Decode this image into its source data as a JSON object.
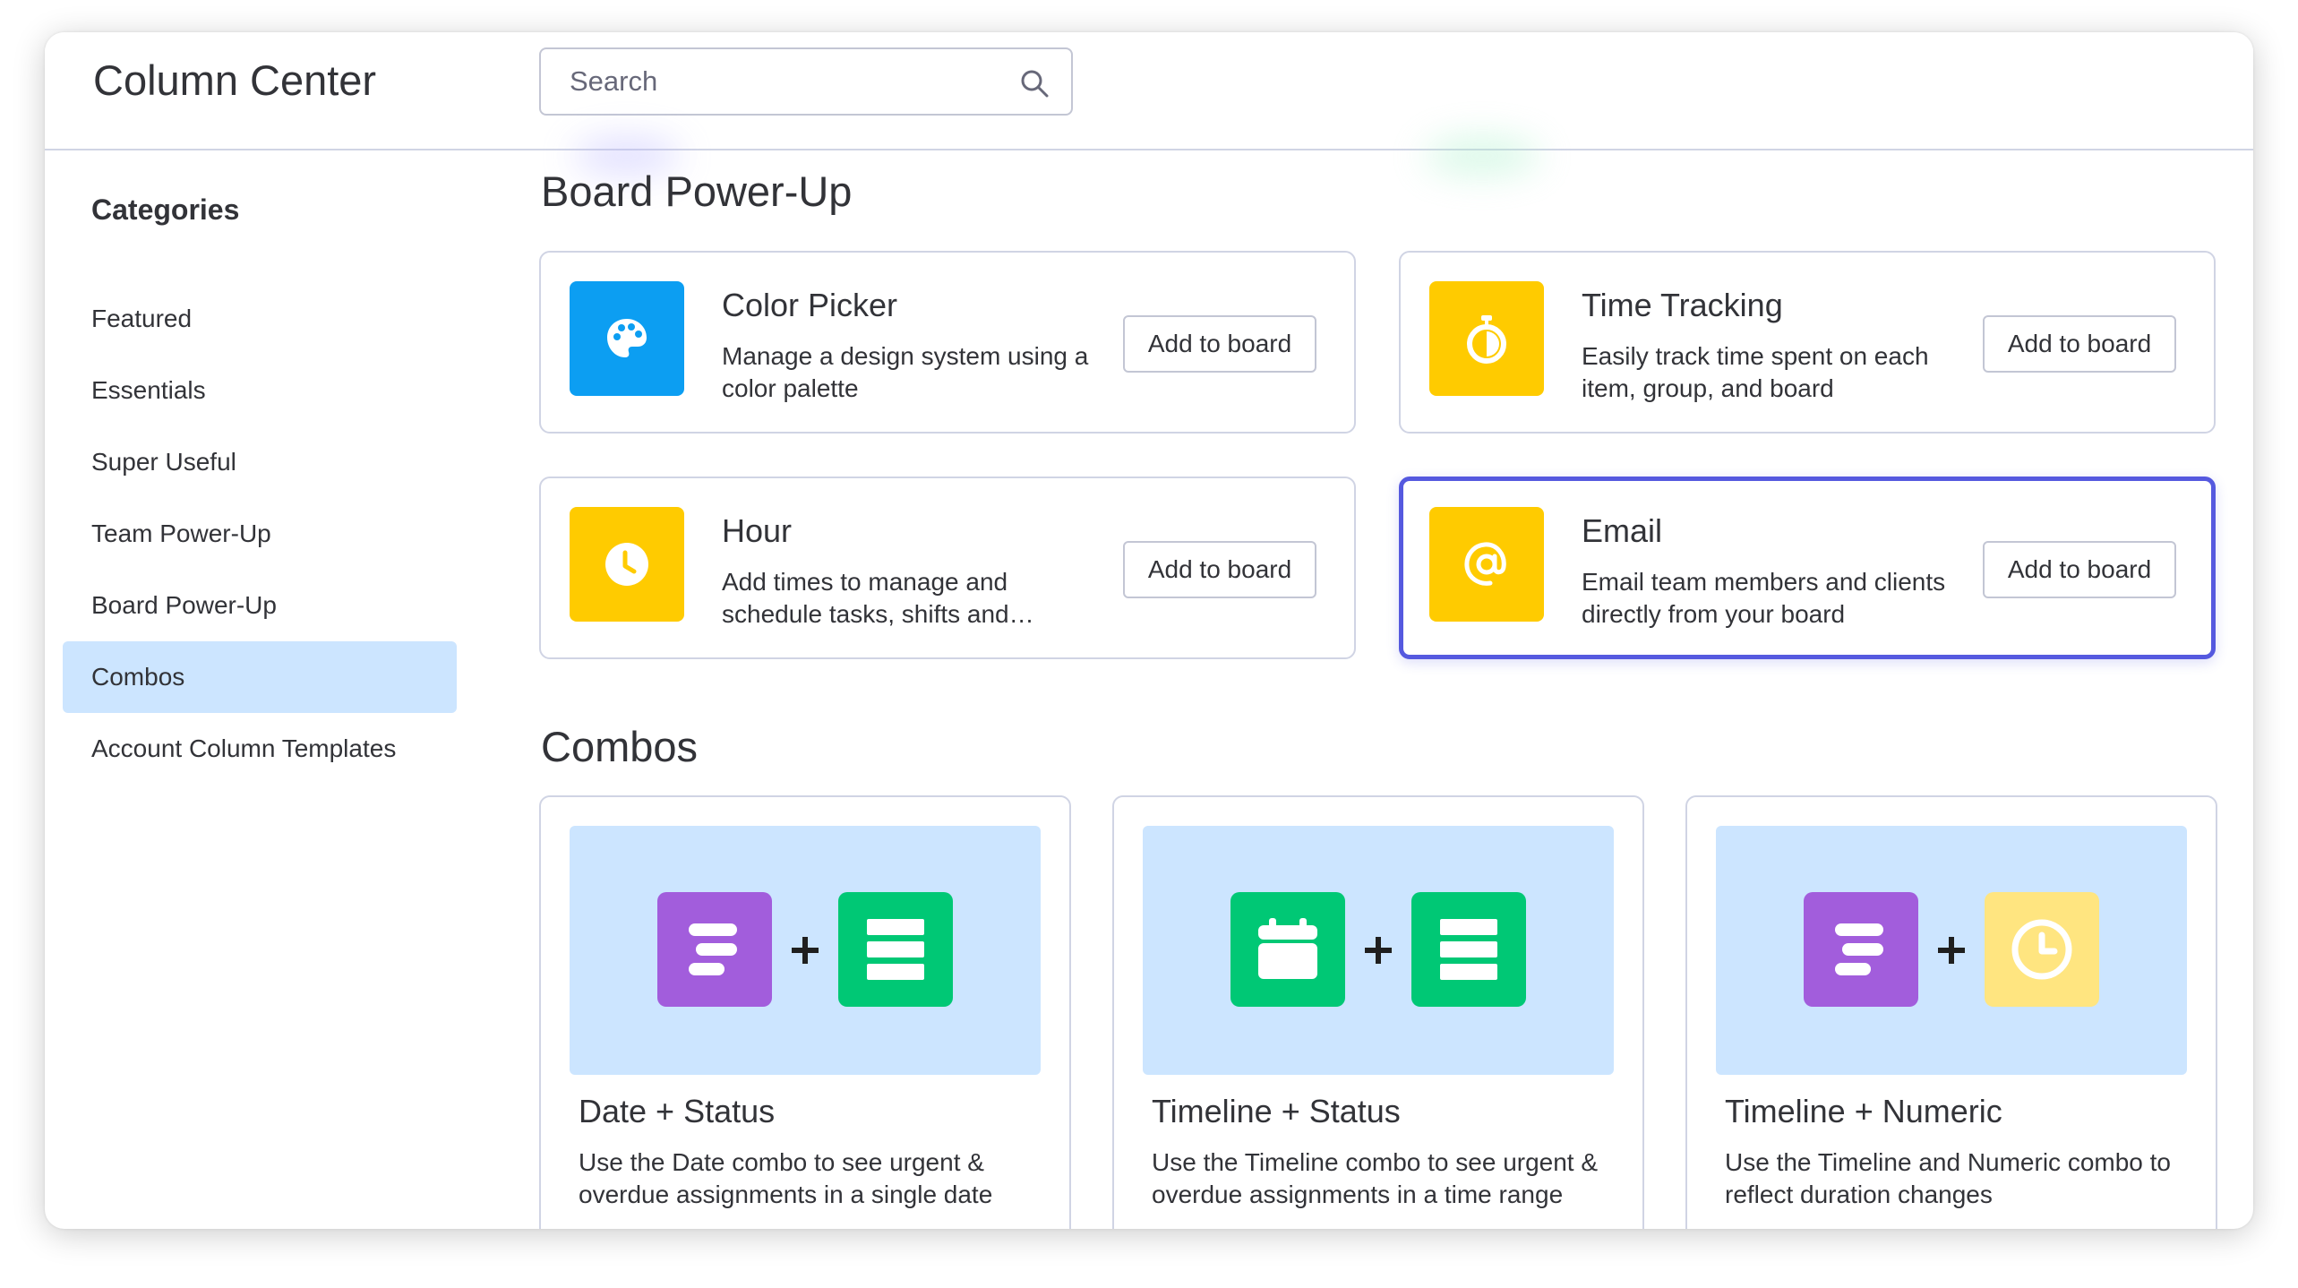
{
  "app": {
    "title": "Column Center"
  },
  "search": {
    "placeholder": "Search"
  },
  "sidebar": {
    "title": "Categories",
    "items": [
      {
        "label": "Featured"
      },
      {
        "label": "Essentials"
      },
      {
        "label": "Super Useful"
      },
      {
        "label": "Team Power-Up"
      },
      {
        "label": "Board Power-Up"
      },
      {
        "label": "Combos"
      },
      {
        "label": "Account Column Templates"
      }
    ],
    "active": "Combos"
  },
  "board_powerup": {
    "title": "Board Power-Up",
    "cards": [
      {
        "title": "Color Picker",
        "description": "Manage a design system using a color palette",
        "button": "Add to board",
        "icon": "palette-icon",
        "color": "#0c9ef2"
      },
      {
        "title": "Time Tracking",
        "description": "Easily track time spent on each item, group, and board",
        "button": "Add to board",
        "icon": "stopwatch-icon",
        "color": "#ffcb00"
      },
      {
        "title": "Hour",
        "description": "Add times to manage and schedule tasks, shifts and…",
        "button": "Add to board",
        "icon": "clock-icon",
        "color": "#ffcb00"
      },
      {
        "title": "Email",
        "description": "Email team members and clients directly from your board",
        "button": "Add to board",
        "icon": "at-sign-icon",
        "color": "#ffcb00"
      }
    ]
  },
  "combos": {
    "title": "Combos",
    "cards": [
      {
        "title": "Date + Status",
        "description": "Use the Date combo to see urgent & overdue assignments in a single date",
        "icons": [
          "timeline-icon",
          "status-icon"
        ]
      },
      {
        "title": "Timeline + Status",
        "description": "Use the Timeline combo to see urgent & overdue assignments in a time range",
        "icons": [
          "calendar-icon",
          "status-icon"
        ]
      },
      {
        "title": "Timeline + Numeric",
        "description": "Use the Timeline and Numeric combo to reflect duration changes",
        "icons": [
          "timeline-icon",
          "clock-icon"
        ]
      }
    ]
  },
  "colors": {
    "accent_highlight": "#5559df",
    "active_category": "#cce5ff",
    "combo_banner": "#cce5ff",
    "blue": "#0c9ef2",
    "yellow": "#ffcb00",
    "light_yellow": "#ffe580",
    "purple": "#a25ddc",
    "green": "#00c875"
  }
}
